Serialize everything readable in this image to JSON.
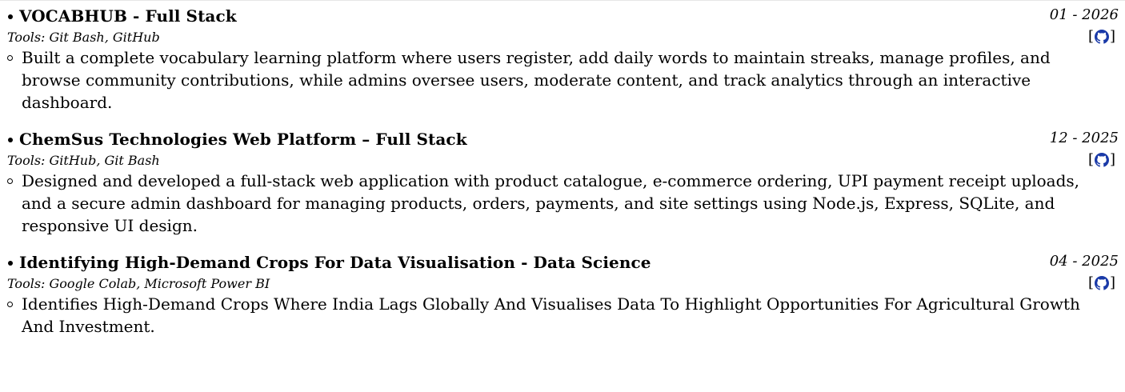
{
  "projects": [
    {
      "title": "VOCABHUB - Full Stack",
      "date": "01 - 2026",
      "tools": "Tools: Git Bash, GitHub",
      "link_open": "[",
      "link_close": "]",
      "link_icon": "github-icon",
      "description": "Built a complete vocabulary learning platform where users register, add daily words to maintain streaks, manage profiles, and browse community contributions, while admins oversee users, moderate content, and track analytics through an interactive dashboard."
    },
    {
      "title": "ChemSus Technologies Web Platform – Full Stack",
      "date": "12 - 2025",
      "tools": "Tools: GitHub, Git Bash",
      "link_open": "[",
      "link_close": "]",
      "link_icon": "github-icon",
      "description": "Designed and developed a full-stack web application with product catalogue, e-commerce ordering, UPI payment receipt uploads, and a secure admin dashboard for managing products, orders, payments, and site settings using Node.js, Express, SQLite, and responsive UI design."
    },
    {
      "title": "Identifying High-Demand Crops For Data Visualisation - Data Science",
      "date": "04 - 2025",
      "tools": "Tools: Google Colab, Microsoft Power BI",
      "link_open": "[",
      "link_close": "]",
      "link_icon": "github-icon",
      "description": "Identifies High-Demand Crops Where India Lags Globally And Visualises Data To Highlight Opportunities For Agricultural Growth And Investment."
    }
  ],
  "colors": {
    "text": "#000000",
    "link_icon": "#1a3aa8"
  }
}
